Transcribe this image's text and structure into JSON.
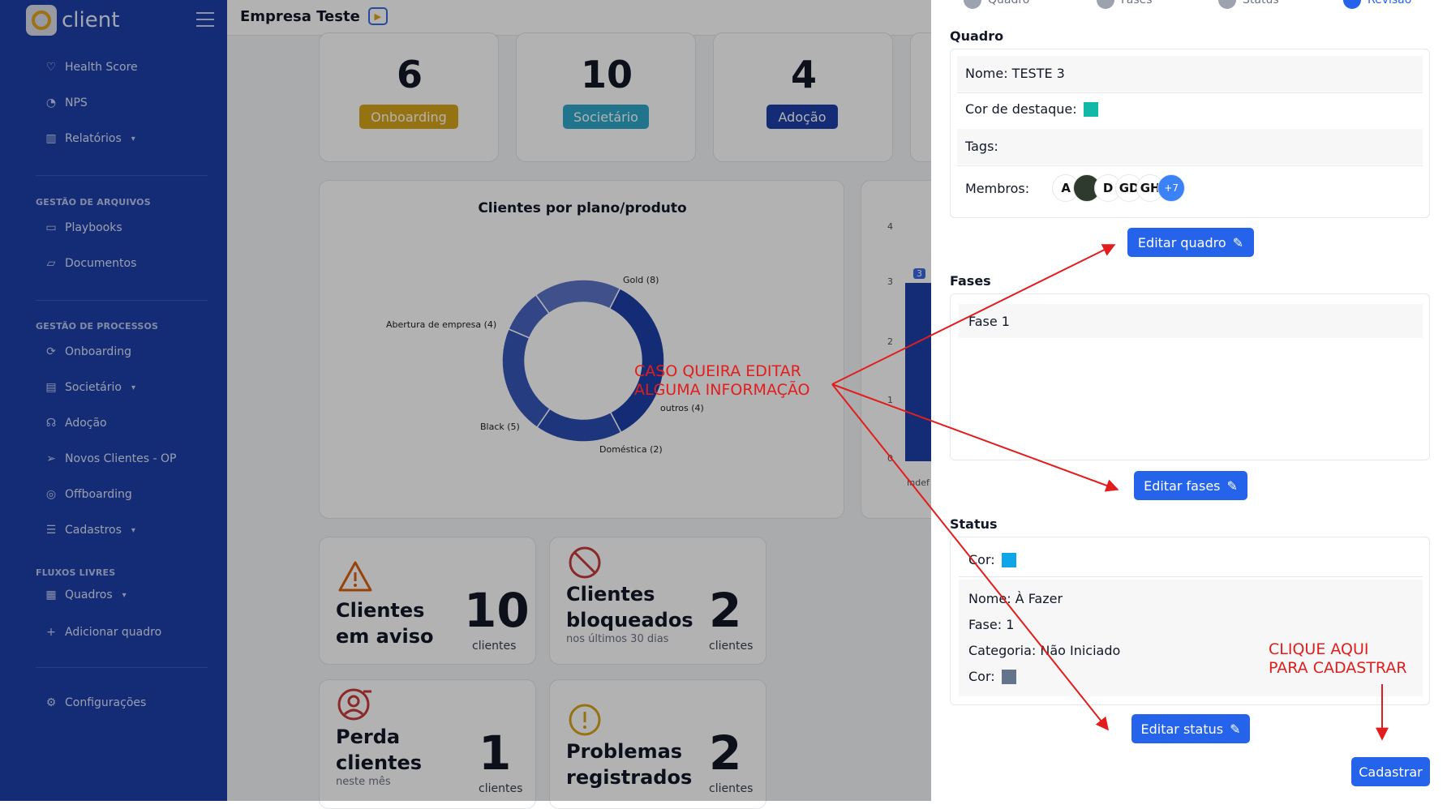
{
  "app": {
    "brand": "client"
  },
  "sidebar": {
    "items": [
      {
        "label": "Health Score"
      },
      {
        "label": "NPS"
      },
      {
        "label": "Relatórios"
      }
    ],
    "section_files": "GESTÃO DE ARQUIVOS",
    "files": [
      {
        "label": "Playbooks"
      },
      {
        "label": "Documentos"
      }
    ],
    "section_processes": "GESTÃO DE PROCESSOS",
    "processes": [
      {
        "label": "Onboarding"
      },
      {
        "label": "Societário"
      },
      {
        "label": "Adoção"
      },
      {
        "label": "Novos Clientes - OP"
      },
      {
        "label": "Offboarding"
      },
      {
        "label": "Cadastros"
      }
    ],
    "section_flows": "FLUXOS LIVRES",
    "flows": [
      {
        "label": "Quadros"
      },
      {
        "label": "Adicionar quadro"
      }
    ],
    "settings": "Configurações"
  },
  "header": {
    "company": "Empresa Teste"
  },
  "kpis": [
    {
      "value": "6",
      "label": "Onboarding",
      "color": "#d6a51c"
    },
    {
      "value": "10",
      "label": "Societário",
      "color": "#2fa7c9"
    },
    {
      "value": "4",
      "label": "Adoção",
      "color": "#1e3fa8"
    }
  ],
  "donut": {
    "title": "Clientes por plano/produto",
    "labels": [
      "Gold (8)",
      "Abertura de empresa (4)",
      "Black (5)",
      "Doméstica (2)",
      "outros (4)"
    ]
  },
  "side_chart": {
    "ticks": [
      "4",
      "3",
      "2",
      "1",
      "0"
    ],
    "bar_label": "3",
    "x_label": "Indef"
  },
  "chart_data": {
    "type": "pie",
    "title": "Clientes por plano/produto",
    "categories": [
      "Gold",
      "Abertura de empresa",
      "Black",
      "Doméstica",
      "outros"
    ],
    "values": [
      8,
      4,
      5,
      2,
      4
    ]
  },
  "stats": [
    {
      "title_1": "Clientes",
      "title_2": "em aviso",
      "sub": "",
      "value": "10",
      "unit": "clientes"
    },
    {
      "title_1": "Clientes",
      "title_2": "bloqueados",
      "sub": "nos últimos 30 dias",
      "value": "2",
      "unit": "clientes"
    },
    {
      "title_1": "Perda",
      "title_2": "clientes",
      "sub": "neste mês",
      "value": "1",
      "unit": "clientes"
    },
    {
      "title_1": "Problemas",
      "title_2": "registrados",
      "sub": "",
      "value": "2",
      "unit": "clientes"
    }
  ],
  "panel": {
    "steps": [
      "Quadro",
      "Fases",
      "Status",
      "Revisão"
    ],
    "quadro": {
      "heading": "Quadro",
      "name": "Nome: TESTE 3",
      "color_label": "Cor de destaque:",
      "color": "#14b8a6",
      "tags": "Tags:",
      "members": "Membros:",
      "avatars": [
        "A",
        "",
        "D",
        "GD",
        "GH",
        "+7"
      ],
      "edit": "Editar quadro"
    },
    "fases": {
      "heading": "Fases",
      "items": [
        "Fase 1"
      ],
      "edit": "Editar fases"
    },
    "status": {
      "heading": "Status",
      "cor_label": "Cor:",
      "cor_color": "#0ea5e9",
      "nome": "Nome: À Fazer",
      "fase": "Fase: 1",
      "categoria": "Categoria: Não Iniciado",
      "cor2_label": "Cor:",
      "cor2_color": "#64748b",
      "edit": "Editar status"
    },
    "submit": "Cadastrar"
  },
  "annotations": {
    "edit_1": "CASO QUEIRA EDITAR",
    "edit_2": "ALGUMA INFORMAÇÃO",
    "click_1": "CLIQUE AQUI",
    "click_2": "PARA CADASTRAR"
  }
}
